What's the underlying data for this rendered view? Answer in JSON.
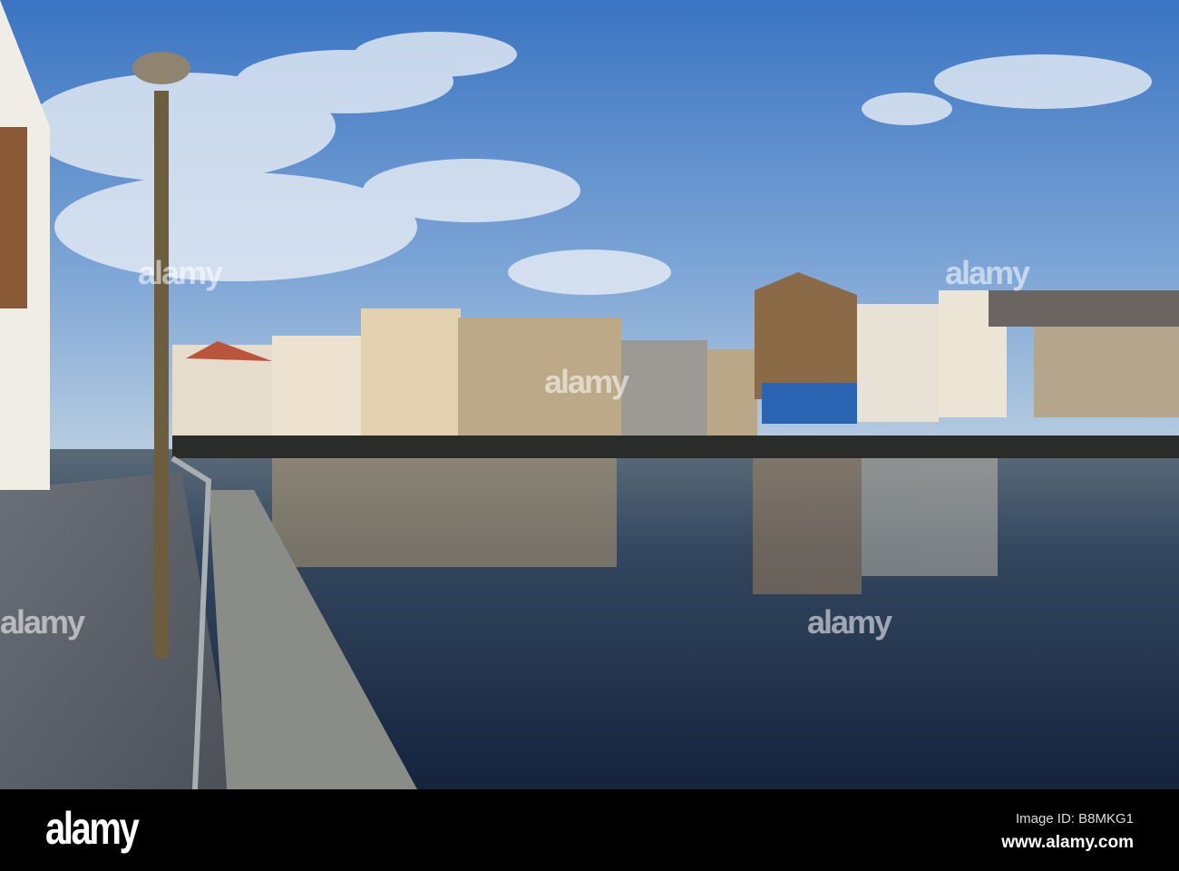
{
  "photo": {
    "subject": "Waterfront buildings reflected in a river under a blue sky",
    "colors": {
      "sky_top": "#3f79c4",
      "sky_bottom": "#a9c3de",
      "water": "#1c2f4e",
      "stone": "#b59a74"
    }
  },
  "watermark": {
    "text": "alamy"
  },
  "footer": {
    "logo": "alamy",
    "image_id": "Image ID: B8MKG1",
    "website": "www.alamy.com"
  }
}
